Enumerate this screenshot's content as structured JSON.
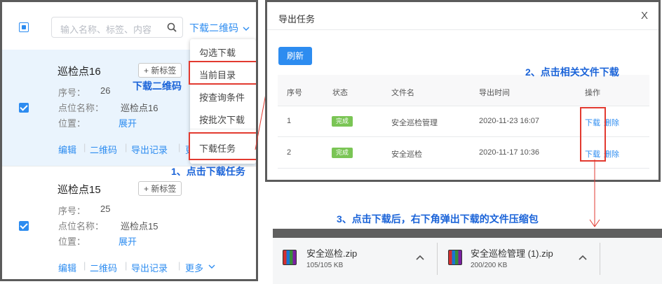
{
  "left": {
    "search_placeholder": "输入名称、标签、内容",
    "qr_dropdown_label": "下载二维码",
    "cards": [
      {
        "title": "巡检点16",
        "tag_btn": "+ 新标签",
        "seq_label": "序号：",
        "seq": "26",
        "name_label": "点位名称：",
        "name": "巡检点16",
        "pos_label": "位置：",
        "expand": "展开",
        "actions": [
          "编辑",
          "二维码",
          "导出记录",
          "更多"
        ]
      },
      {
        "title": "巡检点15",
        "tag_btn": "+ 新标签",
        "seq_label": "序号：",
        "seq": "25",
        "name_label": "点位名称：",
        "name": "巡检点15",
        "pos_label": "位置：",
        "expand": "展开",
        "actions": [
          "编辑",
          "二维码",
          "导出记录",
          "更多"
        ]
      }
    ],
    "dropdown": [
      "勾选下载",
      "当前目录",
      "按查询条件",
      "按批次下载",
      "下载任务"
    ]
  },
  "annotations": {
    "a_qr": "下载二维码",
    "a1": "1、点击下载任务",
    "a2": "2、点击相关文件下载",
    "a3": "3、点击下载后，右下角弹出下载的文件压缩包"
  },
  "modal": {
    "title": "导出任务",
    "close": "X",
    "refresh": "刷新",
    "headers": [
      "序号",
      "状态",
      "文件名",
      "导出时间",
      "操作"
    ],
    "rows": [
      {
        "no": "1",
        "status": "完成",
        "file": "安全巡检管理",
        "time": "2020-11-23 16:07",
        "op_download": "下载",
        "op_delete": "删除"
      },
      {
        "no": "2",
        "status": "完成",
        "file": "安全巡检",
        "time": "2020-11-17 10:36",
        "op_download": "下载",
        "op_delete": "删除"
      }
    ]
  },
  "downloads": [
    {
      "name": "安全巡检.zip",
      "size": "105/105 KB"
    },
    {
      "name": "安全巡检管理 (1).zip",
      "size": "200/200 KB"
    }
  ],
  "colors": {
    "accent": "#2d8cf0",
    "selected_bg": "#eaf4fd",
    "annotation_red": "#e23a30",
    "annotation_blue": "#1a63d8",
    "badge_green": "#7ac555"
  }
}
